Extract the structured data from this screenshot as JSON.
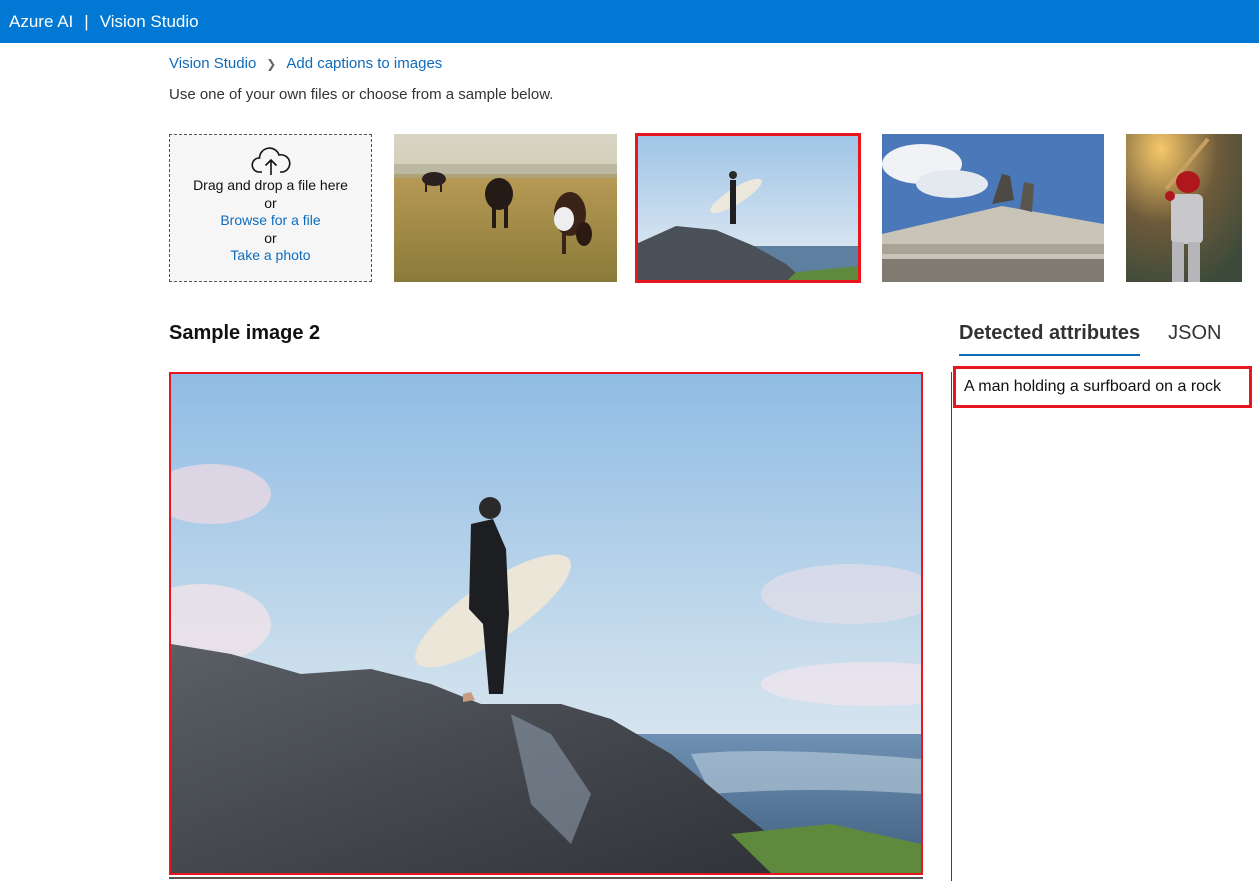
{
  "header": {
    "brand": "Azure AI",
    "separator": "|",
    "product": "Vision Studio"
  },
  "breadcrumb": {
    "root": "Vision Studio",
    "current": "Add captions to images"
  },
  "intro": "Use one of your own files or choose from a sample below.",
  "upload": {
    "drag_text": "Drag and drop a file here",
    "or1": "or",
    "browse_link": "Browse for a file",
    "or2": "or",
    "photo_link": "Take a photo",
    "icon": "cloud-upload-icon"
  },
  "samples": [
    {
      "subject": "cows grazing"
    },
    {
      "subject": "surfer on rock",
      "selected": true
    },
    {
      "subject": "building statues"
    },
    {
      "subject": "baseball batter"
    }
  ],
  "viewer": {
    "title": "Sample image 2"
  },
  "tabs": [
    {
      "label": "Detected attributes",
      "active": true
    },
    {
      "label": "JSON",
      "active": false
    }
  ],
  "result": {
    "caption": "A man holding a surfboard on a rock"
  },
  "colors": {
    "brand": "#0078d4",
    "link": "#0f6cbd",
    "highlight": "#e8161f"
  }
}
